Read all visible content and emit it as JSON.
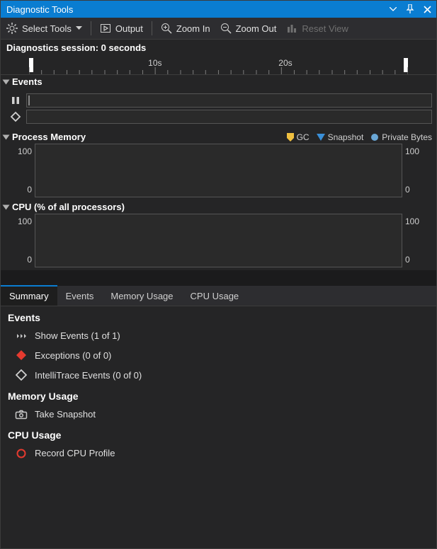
{
  "window": {
    "title": "Diagnostic Tools"
  },
  "toolbar": {
    "selectTools": "Select Tools",
    "output": "Output",
    "zoomIn": "Zoom In",
    "zoomOut": "Zoom Out",
    "resetView": "Reset View"
  },
  "session": {
    "label": "Diagnostics session: 0 seconds"
  },
  "ruler": {
    "labels": [
      "10s",
      "20s"
    ]
  },
  "sections": {
    "events": {
      "title": "Events"
    },
    "memory": {
      "title": "Process Memory",
      "legend": {
        "gc": "GC",
        "snapshot": "Snapshot",
        "private": "Private Bytes"
      }
    },
    "cpu": {
      "title": "CPU (% of all processors)"
    }
  },
  "axes": {
    "top": "100",
    "bottom": "0"
  },
  "tabs": {
    "summary": "Summary",
    "events": "Events",
    "memory": "Memory Usage",
    "cpu": "CPU Usage"
  },
  "summary": {
    "events": {
      "title": "Events",
      "showEvents": "Show Events (1 of 1)",
      "exceptions": "Exceptions (0 of 0)",
      "intelliTrace": "IntelliTrace Events (0 of 0)"
    },
    "memory": {
      "title": "Memory Usage",
      "snapshot": "Take Snapshot"
    },
    "cpu": {
      "title": "CPU Usage",
      "record": "Record CPU Profile"
    }
  },
  "chart_data": [
    {
      "type": "line",
      "title": "Process Memory",
      "series": [
        {
          "name": "Private Bytes",
          "values": []
        }
      ],
      "ylim": [
        0,
        100
      ],
      "ylabel": ""
    },
    {
      "type": "line",
      "title": "CPU (% of all processors)",
      "series": [
        {
          "name": "CPU",
          "values": []
        }
      ],
      "ylim": [
        0,
        100
      ],
      "ylabel": "%"
    }
  ]
}
